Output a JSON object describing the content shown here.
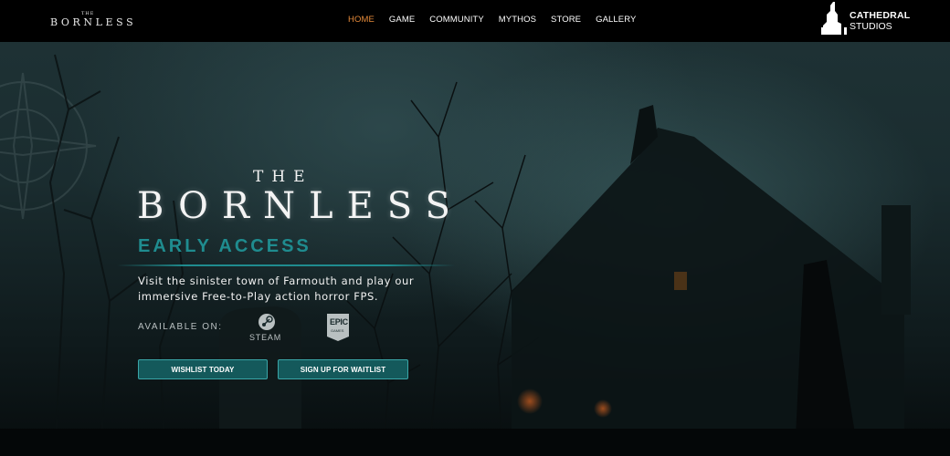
{
  "nav": {
    "logo_the": "THE",
    "logo_word": "BORNLESS",
    "menu": [
      {
        "label": "HOME",
        "active": true
      },
      {
        "label": "GAME"
      },
      {
        "label": "COMMUNITY"
      },
      {
        "label": "MYTHOS"
      },
      {
        "label": "STORE"
      },
      {
        "label": "GALLERY"
      }
    ],
    "studio_line1": "CATHEDRAL",
    "studio_line2": "STUDIOS"
  },
  "hero": {
    "title_the": "THE",
    "title_main": "BORNLESS",
    "subtitle": "EARLY ACCESS",
    "description": "Visit the sinister town of Farmouth and play our immersive Free-to-Play action horror FPS.",
    "available_label": "AVAILABLE ON:",
    "platforms": [
      {
        "name": "STEAM",
        "icon": "steam-icon"
      },
      {
        "name": "EPIC GAMES",
        "icon": "epic-games-icon",
        "line1": "EPIC",
        "line2": "GAMES"
      }
    ],
    "buttons": {
      "wishlist": "WISHLIST TODAY",
      "waitlist": "SIGN UP FOR WAITLIST"
    }
  },
  "colors": {
    "accent": "#1f8c8f",
    "active_nav": "#e58a3a",
    "button_bg": "#14595b"
  }
}
